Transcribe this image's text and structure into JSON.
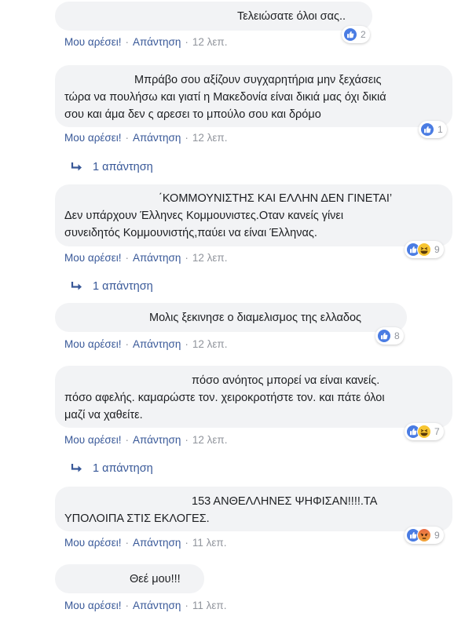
{
  "actions": {
    "like": "Μου αρέσει!",
    "reply": "Απάντηση",
    "dot": "·"
  },
  "comments": [
    {
      "lines": [
        "Τελειώσατε όλοι σας.."
      ],
      "time": "12 λεπ.",
      "reactions": [
        "like"
      ],
      "reaction_count": "2",
      "replies": null
    },
    {
      "lines": [
        "Μπράβο σου αξίζουν συγχαρητήρια μην ξεχάσεις",
        "τώρα να πουλήσω και γιατί η Μακεδονία είναι δικιά μας όχι δικιά",
        "σου και άμα δεν ς αρεσει το μπούλο σου και δρόμο"
      ],
      "time": "12 λεπ.",
      "reactions": [
        "like"
      ],
      "reaction_count": "1",
      "replies": "1 απάντηση"
    },
    {
      "lines": [
        "΄ΚΟΜΜΟΥΝΙΣΤΗΣ ΚΑΙ ΕΛΛΗΝ ΔΕΝ ΓΙΝΕΤΑΙ’",
        "Δεν υπάρχουν Έλληνες Κομμουνιστες.Οταν κανείς γίνει",
        "συνειδητός Κομμουνιστής,παύει να είναι Έλληνας."
      ],
      "time": "12 λεπ.",
      "reactions": [
        "like",
        "haha"
      ],
      "reaction_count": "9",
      "replies": "1 απάντηση"
    },
    {
      "lines": [
        "Μολις ξεκινησε ο διαμελισμος της ελλαδος"
      ],
      "time": "12 λεπ.",
      "reactions": [
        "like"
      ],
      "reaction_count": "8",
      "replies": null
    },
    {
      "lines": [
        "πόσο ανόητος μπορεί να είναι κανείς.",
        "πόσο αφελής. καμαρώστε τον. χειροκροτήστε τον. και πάτε όλοι",
        "μαζί να χαθείτε."
      ],
      "time": "12 λεπ.",
      "reactions": [
        "like",
        "haha"
      ],
      "reaction_count": "7",
      "replies": "1 απάντηση"
    },
    {
      "lines": [
        "153 ΑΝΘΕΛΛΗΝΕΣ ΨΗΦΙΣΑΝ!!!!.ΤΑ",
        "ΥΠΟΛΟΙΠΑ ΣΤΙΣ ΕΚΛΟΓΕΣ."
      ],
      "time": "11 λεπ.",
      "reactions": [
        "like",
        "angry"
      ],
      "reaction_count": "9",
      "replies": null
    },
    {
      "lines": [
        "Θεέ μου!!!"
      ],
      "time": "11 λεπ.",
      "reactions": [],
      "reaction_count": null,
      "replies": null
    }
  ],
  "colors": {
    "bubble": "#f2f3f5",
    "link": "#385898",
    "meta": "#90949c",
    "text": "#1c1e21",
    "like": "#4a7ce3",
    "haha": "#f7c531",
    "angry": "#e86a45"
  }
}
